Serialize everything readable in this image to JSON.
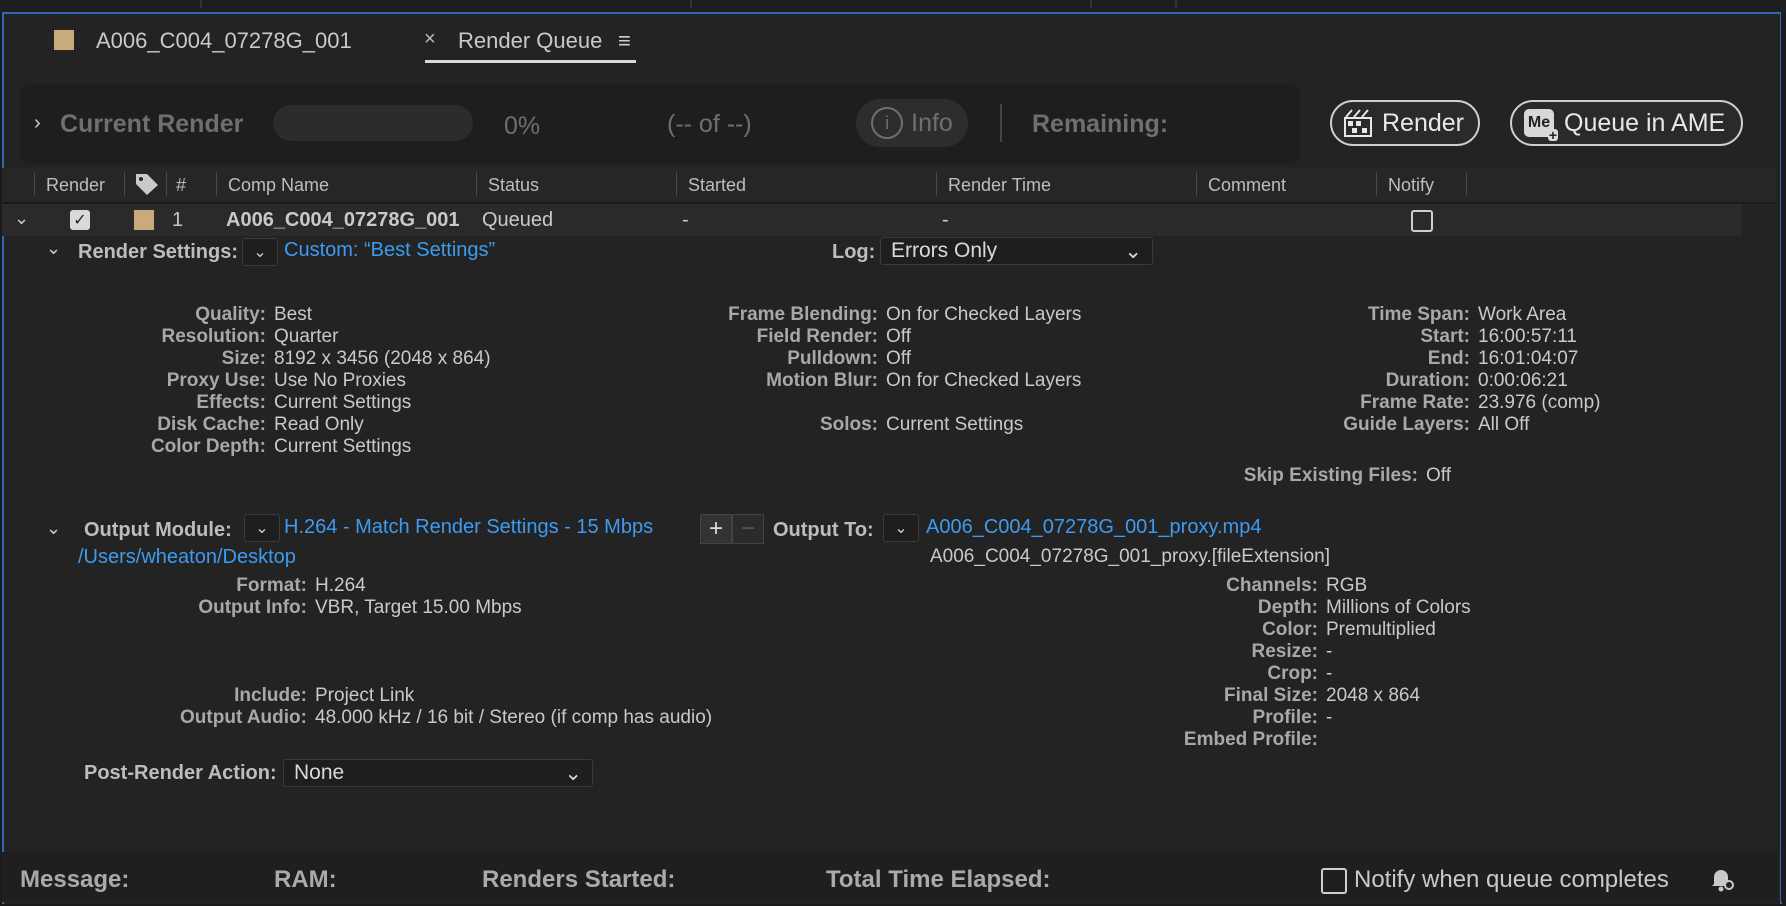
{
  "tabs": {
    "comp_tab": "A006_C004_07278G_001",
    "render_tab": "Render Queue",
    "close_glyph": "×",
    "menu_glyph": "≡"
  },
  "current_render": {
    "label": "Current Render",
    "percent": "0%",
    "progress_fraction": 0,
    "count": "(-- of --)",
    "info_label": "Info",
    "remaining_label": "Remaining:"
  },
  "actions": {
    "render_label": "Render",
    "queue_ame_label": "Queue in AME",
    "me_icon_text": "Me"
  },
  "columns": [
    "Render",
    "#",
    "Comp Name",
    "Status",
    "Started",
    "Render Time",
    "Comment",
    "Notify"
  ],
  "row": {
    "number": "1",
    "comp_name": "A006_C004_07278G_001",
    "status": "Queued",
    "started": "-",
    "render_time": "-",
    "render_checked": true,
    "notify_checked": false,
    "swatch_color": "#c9aa7a"
  },
  "render_settings": {
    "label": "Render Settings:",
    "value": "Custom: “Best Settings”",
    "log_label": "Log:",
    "log_value": "Errors Only",
    "col1": [
      {
        "k": "Quality:",
        "v": "Best"
      },
      {
        "k": "Resolution:",
        "v": "Quarter"
      },
      {
        "k": "Size:",
        "v": "8192 x 3456 (2048 x 864)"
      },
      {
        "k": "Proxy Use:",
        "v": "Use No Proxies"
      },
      {
        "k": "Effects:",
        "v": "Current Settings"
      },
      {
        "k": "Disk Cache:",
        "v": "Read Only"
      },
      {
        "k": "Color Depth:",
        "v": "Current Settings"
      }
    ],
    "col2": [
      {
        "k": "Frame Blending:",
        "v": "On for Checked Layers"
      },
      {
        "k": "Field Render:",
        "v": "Off"
      },
      {
        "k": "Pulldown:",
        "v": "Off"
      },
      {
        "k": "Motion Blur:",
        "v": "On for Checked Layers"
      },
      {
        "k": "",
        "v": ""
      },
      {
        "k": "Solos:",
        "v": "Current Settings"
      }
    ],
    "col3": [
      {
        "k": "Time Span:",
        "v": "Work Area"
      },
      {
        "k": "Start:",
        "v": "16:00:57:11"
      },
      {
        "k": "End:",
        "v": "16:01:04:07"
      },
      {
        "k": "Duration:",
        "v": "0:00:06:21"
      },
      {
        "k": "Frame Rate:",
        "v": "23.976 (comp)"
      },
      {
        "k": "Guide Layers:",
        "v": "All Off"
      }
    ],
    "skip_label": "Skip Existing Files:",
    "skip_value": "Off"
  },
  "output_module": {
    "label": "Output Module:",
    "value": "H.264 - Match Render Settings - 15 Mbps",
    "path": "/Users/wheaton/Desktop",
    "output_to_label": "Output To:",
    "output_file": "A006_C004_07278G_001_proxy.mp4",
    "output_template": "A006_C004_07278G_001_proxy.[fileExtension]",
    "left_a": [
      {
        "k": "Format:",
        "v": "H.264"
      },
      {
        "k": "Output Info:",
        "v": "VBR, Target 15.00 Mbps"
      }
    ],
    "left_b": [
      {
        "k": "Include:",
        "v": "Project Link"
      },
      {
        "k": "Output Audio:",
        "v": "48.000 kHz / 16 bit / Stereo (if comp has audio)"
      }
    ],
    "right": [
      {
        "k": "Channels:",
        "v": "RGB"
      },
      {
        "k": "Depth:",
        "v": "Millions of Colors"
      },
      {
        "k": "Color:",
        "v": "Premultiplied"
      },
      {
        "k": "Resize:",
        "v": "-"
      },
      {
        "k": "Crop:",
        "v": "-"
      },
      {
        "k": "Final Size:",
        "v": "2048 x 864"
      },
      {
        "k": "Profile:",
        "v": "-"
      },
      {
        "k": "Embed Profile:",
        "v": ""
      }
    ],
    "plus": "+",
    "minus": "−"
  },
  "post_render": {
    "label": "Post-Render Action:",
    "value": "None"
  },
  "footer": {
    "message": "Message:",
    "ram": "RAM:",
    "renders_started": "Renders Started:",
    "total_time": "Total Time Elapsed:",
    "notify_label": "Notify when queue completes"
  },
  "colors": {
    "accent": "#3d9bf0",
    "panel_border": "#2f67b3",
    "swatch": "#c9aa7a"
  }
}
